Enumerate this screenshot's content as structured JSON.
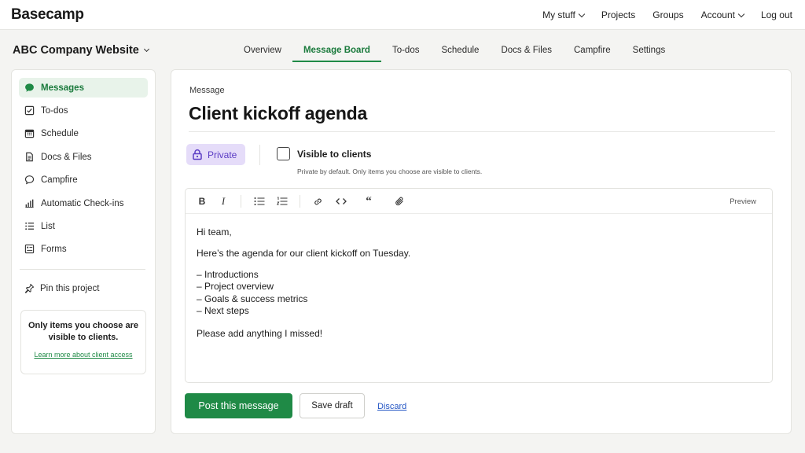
{
  "app": {
    "brand": "Basecamp"
  },
  "topnav": [
    {
      "label": "My stuff",
      "dropdown": true
    },
    {
      "label": "Projects",
      "dropdown": false
    },
    {
      "label": "Groups",
      "dropdown": false
    },
    {
      "label": "Account",
      "dropdown": true
    },
    {
      "label": "Log out",
      "dropdown": false
    }
  ],
  "project": {
    "name": "ABC Company Website"
  },
  "tabs": [
    {
      "label": "Overview"
    },
    {
      "label": "Message Board",
      "active": true
    },
    {
      "label": "To-dos"
    },
    {
      "label": "Schedule"
    },
    {
      "label": "Docs & Files"
    },
    {
      "label": "Campfire"
    },
    {
      "label": "Settings"
    }
  ],
  "sidebar": {
    "items": [
      {
        "label": "Messages",
        "icon": "chat-bubble-icon",
        "active": true
      },
      {
        "label": "To-dos",
        "icon": "checkbox-icon"
      },
      {
        "label": "Schedule",
        "icon": "calendar-icon"
      },
      {
        "label": "Docs & Files",
        "icon": "document-icon"
      },
      {
        "label": "Campfire",
        "icon": "speech-bubble-icon"
      },
      {
        "label": "Automatic Check-ins",
        "icon": "bar-chart-icon"
      },
      {
        "label": "List",
        "icon": "list-icon"
      },
      {
        "label": "Forms",
        "icon": "form-icon"
      }
    ],
    "pin_label": "Pin this project",
    "info_text": "Only items you choose are visible to clients.",
    "info_link": "Learn more about client access"
  },
  "message": {
    "eyebrow": "Message",
    "title": "Client kickoff agenda",
    "private_label": "Private",
    "visible_label": "Visible to clients",
    "visible_checked": false,
    "visible_hint": "Private by default. Only items you choose are visible to clients.",
    "preview_label": "Preview",
    "body": {
      "greeting": "Hi team,",
      "intro": "Here’s the agenda for our client kickoff on Tuesday.",
      "items": [
        "– Introductions",
        "– Project overview",
        "– Goals & success metrics",
        "– Next steps"
      ],
      "closing": "Please add anything I missed!"
    }
  },
  "actions": {
    "post": "Post this message",
    "draft": "Save draft",
    "discard": "Discard"
  },
  "colors": {
    "accent_green": "#1f8a46",
    "private_bg": "#e5dcf9",
    "private_fg": "#5b3cc4",
    "link_blue": "#2456c4"
  }
}
